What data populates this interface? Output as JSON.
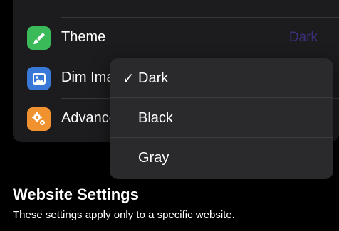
{
  "settings_group": {
    "rows": [
      {
        "label": "Theme",
        "value": "Dark",
        "icon": "paintbrush-icon",
        "icon_color": "#3bba5a"
      },
      {
        "label": "Dim Images",
        "icon": "image-icon",
        "icon_color": "#3a78d8"
      },
      {
        "label": "Advanced",
        "icon": "gears-icon",
        "icon_color": "#f0922f"
      }
    ]
  },
  "theme_menu": {
    "selected_mark": "✓",
    "options": [
      "Dark",
      "Black",
      "Gray"
    ],
    "selected": "Dark"
  },
  "website_settings": {
    "title": "Website Settings",
    "subtitle": "These settings apply only to a specific website."
  },
  "colors": {
    "background": "#000000",
    "group_background": "#1c1c1e",
    "menu_background": "#2a2a2d",
    "value_text": "#3b2f7a"
  }
}
